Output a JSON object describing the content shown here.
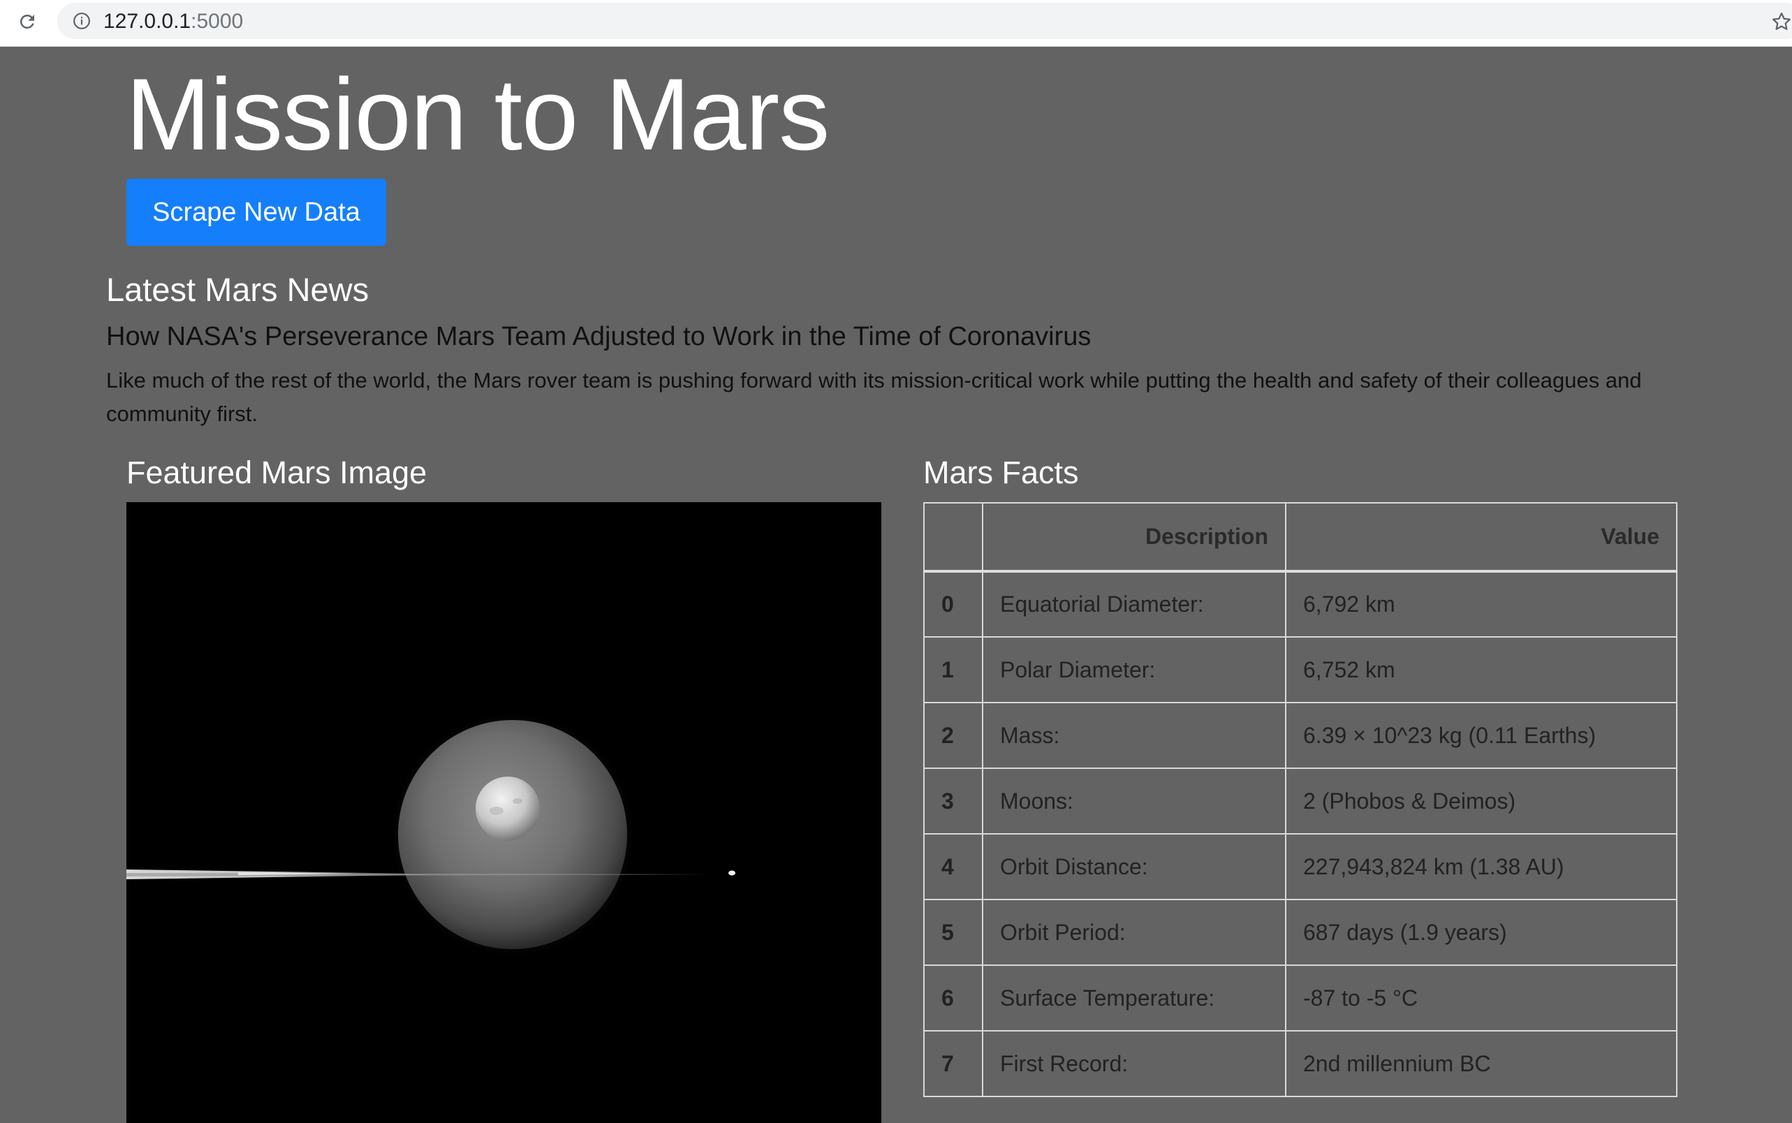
{
  "browser": {
    "url_host": "127.0.0.1",
    "url_port": ":5000"
  },
  "header": {
    "title": "Mission to Mars",
    "scrape_button_label": "Scrape New Data"
  },
  "news": {
    "section_heading": "Latest Mars News",
    "title": "How NASA's Perseverance Mars Team Adjusted to Work in the Time of Coronavirus",
    "paragraph": "Like much of the rest of the world, the Mars rover team is pushing forward with its mission-critical work while putting the health and safety of their colleagues and community first."
  },
  "featured": {
    "heading": "Featured Mars Image"
  },
  "facts": {
    "heading": "Mars Facts",
    "columns": [
      "",
      "Description",
      "Value"
    ],
    "rows": [
      {
        "index": "0",
        "description": "Equatorial Diameter:",
        "value": "6,792 km"
      },
      {
        "index": "1",
        "description": "Polar Diameter:",
        "value": "6,752 km"
      },
      {
        "index": "2",
        "description": "Mass:",
        "value": "6.39 × 10^23 kg (0.11 Earths)"
      },
      {
        "index": "3",
        "description": "Moons:",
        "value": "2 (Phobos & Deimos)"
      },
      {
        "index": "4",
        "description": "Orbit Distance:",
        "value": "227,943,824 km (1.38 AU)"
      },
      {
        "index": "5",
        "description": "Orbit Period:",
        "value": "687 days (1.9 years)"
      },
      {
        "index": "6",
        "description": "Surface Temperature:",
        "value": "-87 to -5 °C"
      },
      {
        "index": "7",
        "description": "First Record:",
        "value": "2nd millennium BC"
      }
    ]
  },
  "icons": {
    "reload": "reload-icon",
    "info": "info-icon",
    "star": "star-icon"
  },
  "colors": {
    "page_background": "#636363",
    "button_primary": "#157efb",
    "table_border": "#d9d9d9"
  }
}
